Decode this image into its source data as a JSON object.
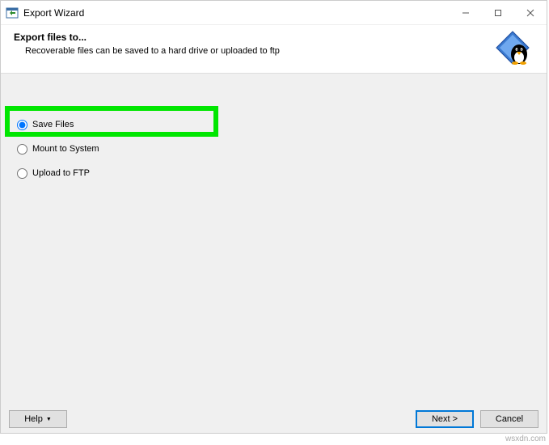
{
  "titlebar": {
    "title": "Export Wizard"
  },
  "header": {
    "title": "Export files to...",
    "subtitle": "Recoverable files can be saved to a hard drive or uploaded to ftp"
  },
  "options": {
    "save_files": "Save Files",
    "mount_to_system": "Mount to System",
    "upload_to_ftp": "Upload to FTP"
  },
  "footer": {
    "help": "Help",
    "next": "Next >",
    "cancel": "Cancel"
  },
  "watermark": "wsxdn.com"
}
